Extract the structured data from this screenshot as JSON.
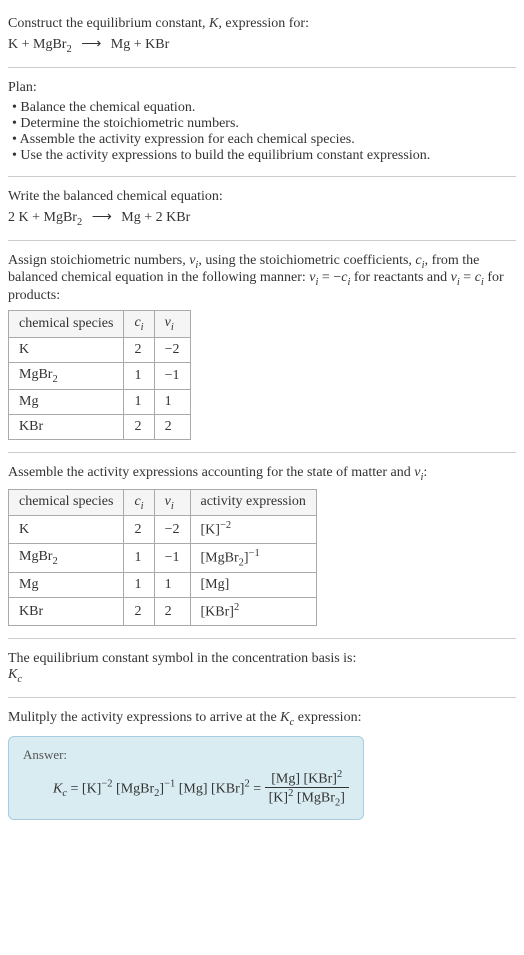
{
  "title": {
    "prefix": "Construct the equilibrium constant, ",
    "k": "K",
    "suffix": ", expression for:"
  },
  "top_equation": {
    "lhs": "K + MgBr",
    "lhs_sub": "2",
    "arrow": "⟶",
    "rhs": "Mg + KBr"
  },
  "plan": {
    "heading": "Plan:",
    "items": [
      "• Balance the chemical equation.",
      "• Determine the stoichiometric numbers.",
      "• Assemble the activity expression for each chemical species.",
      "• Use the activity expressions to build the equilibrium constant expression."
    ]
  },
  "balanced": {
    "heading": "Write the balanced chemical equation:",
    "lhs1": "2 K + MgBr",
    "lhs_sub": "2",
    "arrow": "⟶",
    "rhs": "Mg + 2 KBr"
  },
  "stoich": {
    "text1": "Assign stoichiometric numbers, ",
    "nu_i": "ν",
    "nu_sub": "i",
    "text2": ", using the stoichiometric coefficients, ",
    "c_i": "c",
    "c_sub": "i",
    "text3": ", from the balanced chemical equation in the following manner: ",
    "eq1a": "ν",
    "eq1b": "i",
    "eq1c": " = −",
    "eq1d": "c",
    "eq1e": "i",
    "text4": " for reactants and ",
    "eq2a": "ν",
    "eq2b": "i",
    "eq2c": " = ",
    "eq2d": "c",
    "eq2e": "i",
    "text5": " for products:"
  },
  "table1": {
    "headers": [
      "chemical species",
      "c",
      "ν"
    ],
    "header_sub": "i",
    "rows": [
      {
        "species": "K",
        "species_sub": "",
        "c": "2",
        "nu": "−2"
      },
      {
        "species": "MgBr",
        "species_sub": "2",
        "c": "1",
        "nu": "−1"
      },
      {
        "species": "Mg",
        "species_sub": "",
        "c": "1",
        "nu": "1"
      },
      {
        "species": "KBr",
        "species_sub": "",
        "c": "2",
        "nu": "2"
      }
    ]
  },
  "assemble": {
    "text1": "Assemble the activity expressions accounting for the state of matter and ",
    "nu": "ν",
    "nu_sub": "i",
    "text2": ":"
  },
  "table2": {
    "headers": [
      "chemical species",
      "c",
      "ν",
      "activity expression"
    ],
    "header_sub": "i",
    "rows": [
      {
        "species": "K",
        "species_sub": "",
        "c": "2",
        "nu": "−2",
        "act": "[K]",
        "act_sup": "−2"
      },
      {
        "species": "MgBr",
        "species_sub": "2",
        "c": "1",
        "nu": "−1",
        "act": "[MgBr",
        "act_sub": "2",
        "act_close": "]",
        "act_sup": "−1"
      },
      {
        "species": "Mg",
        "species_sub": "",
        "c": "1",
        "nu": "1",
        "act": "[Mg]",
        "act_sup": ""
      },
      {
        "species": "KBr",
        "species_sub": "",
        "c": "2",
        "nu": "2",
        "act": "[KBr]",
        "act_sup": "2"
      }
    ]
  },
  "symbol": {
    "text": "The equilibrium constant symbol in the concentration basis is:",
    "k": "K",
    "sub": "c"
  },
  "multiply": {
    "text1": "Mulitply the activity expressions to arrive at the ",
    "k": "K",
    "sub": "c",
    "text2": " expression:"
  },
  "answer": {
    "label": "Answer:",
    "kc": "K",
    "kc_sub": "c",
    "eq": " = [K]",
    "s1": "−2",
    "p2": " [MgBr",
    "p2sub": "2",
    "p2b": "]",
    "s2": "−1",
    "p3": " [Mg] [KBr]",
    "s3": "2",
    "eq2": " = ",
    "num1": "[Mg] [KBr]",
    "num1sup": "2",
    "den1": "[K]",
    "den1sup": "2",
    "den2": " [MgBr",
    "den2sub": "2",
    "den2b": "]"
  }
}
